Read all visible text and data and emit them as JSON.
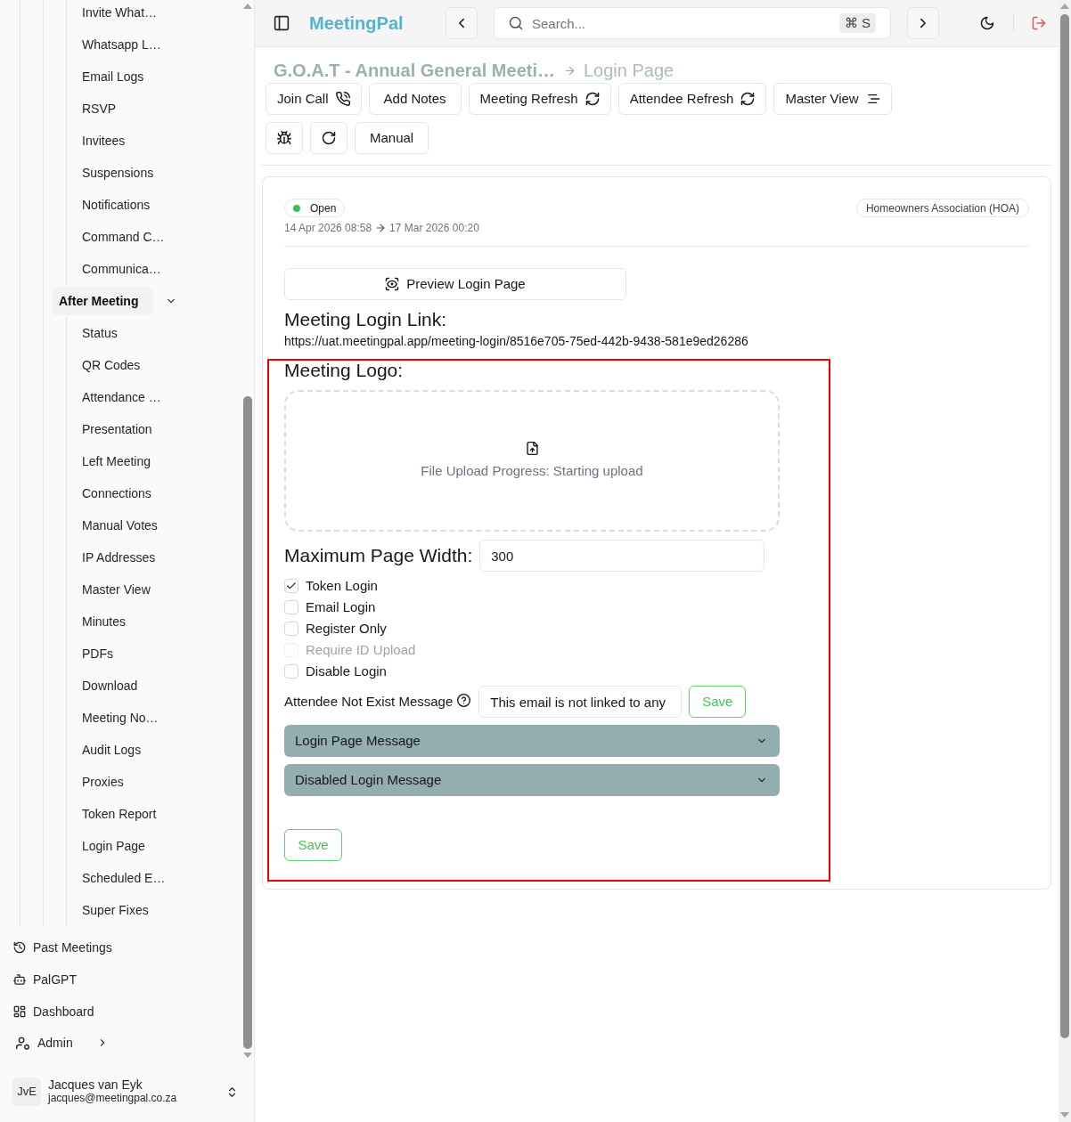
{
  "sidebar": {
    "items": [
      {
        "label": "Invite What…",
        "selected": false
      },
      {
        "label": "Whatsapp L…",
        "selected": false
      },
      {
        "label": "Email Logs",
        "selected": false
      },
      {
        "label": "RSVP",
        "selected": false
      },
      {
        "label": "Invitees",
        "selected": false
      },
      {
        "label": "Suspensions",
        "selected": false
      },
      {
        "label": "Notifications",
        "selected": false
      },
      {
        "label": "Command C…",
        "selected": false
      },
      {
        "label": "Communica…",
        "selected": false
      }
    ],
    "section": {
      "label": "After Meeting",
      "expanded": true,
      "children": [
        {
          "label": "Status",
          "selected": false
        },
        {
          "label": "QR Codes",
          "selected": false
        },
        {
          "label": "Attendance …",
          "selected": false
        },
        {
          "label": "Presentation",
          "selected": false
        },
        {
          "label": "Left Meeting",
          "selected": false
        },
        {
          "label": "Connections",
          "selected": false
        },
        {
          "label": "Manual Votes",
          "selected": false
        },
        {
          "label": "IP Addresses",
          "selected": false
        },
        {
          "label": "Master View",
          "selected": false
        },
        {
          "label": "Minutes",
          "selected": false
        },
        {
          "label": "PDFs",
          "selected": false
        },
        {
          "label": "Download",
          "selected": false
        },
        {
          "label": "Meeting No…",
          "selected": false
        },
        {
          "label": "Audit Logs",
          "selected": false
        },
        {
          "label": "Proxies",
          "selected": false
        },
        {
          "label": "Token Report",
          "selected": false
        },
        {
          "label": "Login Page",
          "selected": false
        },
        {
          "label": "Scheduled E…",
          "selected": false
        },
        {
          "label": "Super Fixes",
          "selected": false
        }
      ]
    },
    "nav": [
      {
        "label": "Past Meetings"
      },
      {
        "label": "PalGPT"
      },
      {
        "label": "Dashboard"
      }
    ],
    "admin": {
      "label": "Admin",
      "expanded": false
    },
    "user": {
      "initials": "JvE",
      "name": "Jacques van Eyk",
      "email": "jacques@meetingpal.co.za"
    }
  },
  "topbar": {
    "brand": "MeetingPal",
    "search": {
      "placeholder": "Search...",
      "shortcut": "⌘ S"
    }
  },
  "breadcrumb": {
    "meeting": "G.O.A.T - Annual General Meeti…",
    "page": "Login Page"
  },
  "actions": [
    {
      "label": "Join Call"
    },
    {
      "label": "Add Notes"
    },
    {
      "label": "Meeting Refresh"
    },
    {
      "label": "Attendee Refresh"
    },
    {
      "label": "Master View"
    }
  ],
  "tools": [
    {
      "kind": "icon"
    },
    {
      "kind": "icon"
    },
    {
      "kind": "text",
      "label": "Manual"
    }
  ],
  "card": {
    "status": {
      "label": "Open"
    },
    "dates": {
      "start": "14 Apr 2026 08:58",
      "end": "17 Mar 2026 00:20"
    },
    "organization": "Homeowners Association (HOA)",
    "preview_button": "Preview Login Page",
    "link_heading": "Meeting Login Link:",
    "link": "https://uat.meetingpal.app/meeting-login/8516e705-75ed-442b-9438-581e9ed26286",
    "logo_heading": "Meeting Logo:",
    "upload": {
      "status": "File Upload Progress: Starting upload"
    },
    "width_field": {
      "label": "Maximum Page Width:",
      "value": "300"
    },
    "options": [
      {
        "label": "Token Login",
        "checked": true,
        "disabled": false
      },
      {
        "label": "Email Login",
        "checked": false,
        "disabled": false
      },
      {
        "label": "Register Only",
        "checked": false,
        "disabled": false
      },
      {
        "label": "Require ID Upload",
        "checked": false,
        "disabled": true
      },
      {
        "label": "Disable Login",
        "checked": false,
        "disabled": false
      }
    ],
    "not_exist_field": {
      "label": "Attendee Not Exist Message",
      "value": "This email is not linked to any",
      "button": "Save"
    },
    "sections": [
      {
        "label": "Login Page Message",
        "expanded": false
      },
      {
        "label": "Disabled Login Message",
        "expanded": false
      }
    ],
    "save_button": "Save"
  }
}
